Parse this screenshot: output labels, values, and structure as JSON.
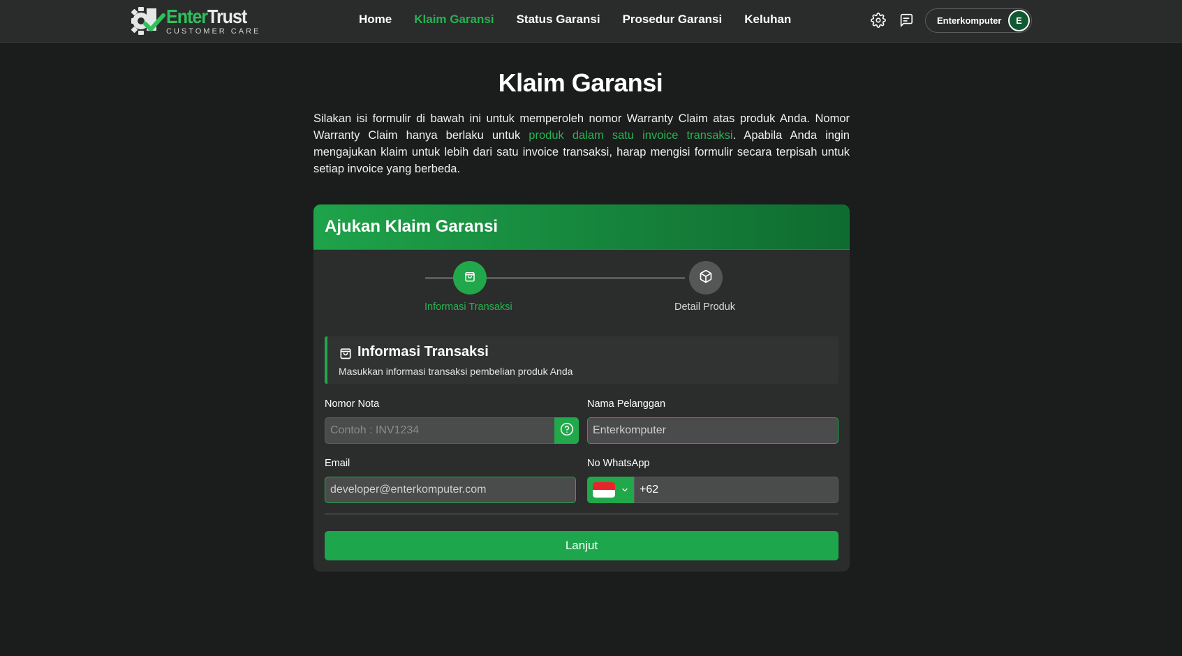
{
  "brand": {
    "name_part1": "Enter",
    "name_part2": "Trust",
    "tagline": "CUSTOMER CARE",
    "accent": "#26b351"
  },
  "nav": {
    "items": [
      {
        "label": "Home",
        "active": false
      },
      {
        "label": "Klaim Garansi",
        "active": true
      },
      {
        "label": "Status Garansi",
        "active": false
      },
      {
        "label": "Prosedur Garansi",
        "active": false
      },
      {
        "label": "Keluhan",
        "active": false
      }
    ],
    "icons": [
      "gear-icon",
      "chat-icon"
    ],
    "user": {
      "name": "Enterkomputer",
      "initial": "E"
    }
  },
  "page": {
    "title": "Klaim Garansi",
    "intro_before": "Silakan isi formulir di bawah ini untuk memperoleh nomor Warranty Claim atas produk Anda. Nomor Warranty Claim hanya berlaku untuk ",
    "intro_highlight": "produk dalam satu invoice transaksi",
    "intro_after": ". Apabila Anda ingin mengajukan klaim untuk lebih dari satu invoice transaksi, harap mengisi formulir secara terpisah untuk setiap invoice yang berbeda."
  },
  "card": {
    "title": "Ajukan Klaim Garansi",
    "steps": [
      {
        "label": "Informasi Transaksi",
        "icon": "bag-icon",
        "active": true
      },
      {
        "label": "Detail Produk",
        "icon": "box-icon",
        "active": false
      }
    ],
    "section": {
      "title": "Informasi Transaksi",
      "icon": "bag-icon",
      "description": "Masukkan informasi transaksi pembelian produk Anda"
    },
    "form": {
      "nomor_nota": {
        "label": "Nomor Nota",
        "placeholder": "Contoh : INV1234",
        "value": ""
      },
      "nama_pelanggan": {
        "label": "Nama Pelanggan",
        "value": "Enterkomputer"
      },
      "email": {
        "label": "Email",
        "value": "developer@enterkomputer.com"
      },
      "whatsapp": {
        "label": "No WhatsApp",
        "prefix": "+62",
        "flag": "indonesia-flag-icon"
      },
      "submit_label": "Lanjut"
    }
  }
}
